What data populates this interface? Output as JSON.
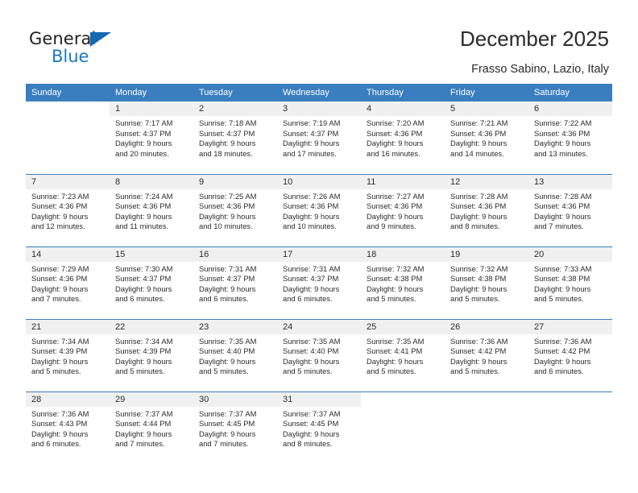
{
  "brand": {
    "name_part1": "General",
    "name_part2": "Blue",
    "triangle_color": "#1668b3",
    "blue_color": "#1b7ac4"
  },
  "header": {
    "title": "December 2025",
    "subtitle": "Frasso Sabino, Lazio, Italy"
  },
  "theme": {
    "header_blue": "#3a7ebf",
    "daynum_band": "#f0f0f0",
    "text": "#2b2b2b"
  },
  "weekday_headers": [
    "Sunday",
    "Monday",
    "Tuesday",
    "Wednesday",
    "Thursday",
    "Friday",
    "Saturday"
  ],
  "weeks": [
    [
      {
        "day": "",
        "sunrise": "",
        "sunset": "",
        "daylight1": "",
        "daylight2": "",
        "blank": true
      },
      {
        "day": "1",
        "sunrise": "Sunrise: 7:17 AM",
        "sunset": "Sunset: 4:37 PM",
        "daylight1": "Daylight: 9 hours",
        "daylight2": "and 20 minutes."
      },
      {
        "day": "2",
        "sunrise": "Sunrise: 7:18 AM",
        "sunset": "Sunset: 4:37 PM",
        "daylight1": "Daylight: 9 hours",
        "daylight2": "and 18 minutes."
      },
      {
        "day": "3",
        "sunrise": "Sunrise: 7:19 AM",
        "sunset": "Sunset: 4:37 PM",
        "daylight1": "Daylight: 9 hours",
        "daylight2": "and 17 minutes."
      },
      {
        "day": "4",
        "sunrise": "Sunrise: 7:20 AM",
        "sunset": "Sunset: 4:36 PM",
        "daylight1": "Daylight: 9 hours",
        "daylight2": "and 16 minutes."
      },
      {
        "day": "5",
        "sunrise": "Sunrise: 7:21 AM",
        "sunset": "Sunset: 4:36 PM",
        "daylight1": "Daylight: 9 hours",
        "daylight2": "and 14 minutes."
      },
      {
        "day": "6",
        "sunrise": "Sunrise: 7:22 AM",
        "sunset": "Sunset: 4:36 PM",
        "daylight1": "Daylight: 9 hours",
        "daylight2": "and 13 minutes."
      }
    ],
    [
      {
        "day": "7",
        "sunrise": "Sunrise: 7:23 AM",
        "sunset": "Sunset: 4:36 PM",
        "daylight1": "Daylight: 9 hours",
        "daylight2": "and 12 minutes."
      },
      {
        "day": "8",
        "sunrise": "Sunrise: 7:24 AM",
        "sunset": "Sunset: 4:36 PM",
        "daylight1": "Daylight: 9 hours",
        "daylight2": "and 11 minutes."
      },
      {
        "day": "9",
        "sunrise": "Sunrise: 7:25 AM",
        "sunset": "Sunset: 4:36 PM",
        "daylight1": "Daylight: 9 hours",
        "daylight2": "and 10 minutes."
      },
      {
        "day": "10",
        "sunrise": "Sunrise: 7:26 AM",
        "sunset": "Sunset: 4:36 PM",
        "daylight1": "Daylight: 9 hours",
        "daylight2": "and 10 minutes."
      },
      {
        "day": "11",
        "sunrise": "Sunrise: 7:27 AM",
        "sunset": "Sunset: 4:36 PM",
        "daylight1": "Daylight: 9 hours",
        "daylight2": "and 9 minutes."
      },
      {
        "day": "12",
        "sunrise": "Sunrise: 7:28 AM",
        "sunset": "Sunset: 4:36 PM",
        "daylight1": "Daylight: 9 hours",
        "daylight2": "and 8 minutes."
      },
      {
        "day": "13",
        "sunrise": "Sunrise: 7:28 AM",
        "sunset": "Sunset: 4:36 PM",
        "daylight1": "Daylight: 9 hours",
        "daylight2": "and 7 minutes."
      }
    ],
    [
      {
        "day": "14",
        "sunrise": "Sunrise: 7:29 AM",
        "sunset": "Sunset: 4:36 PM",
        "daylight1": "Daylight: 9 hours",
        "daylight2": "and 7 minutes."
      },
      {
        "day": "15",
        "sunrise": "Sunrise: 7:30 AM",
        "sunset": "Sunset: 4:37 PM",
        "daylight1": "Daylight: 9 hours",
        "daylight2": "and 6 minutes."
      },
      {
        "day": "16",
        "sunrise": "Sunrise: 7:31 AM",
        "sunset": "Sunset: 4:37 PM",
        "daylight1": "Daylight: 9 hours",
        "daylight2": "and 6 minutes."
      },
      {
        "day": "17",
        "sunrise": "Sunrise: 7:31 AM",
        "sunset": "Sunset: 4:37 PM",
        "daylight1": "Daylight: 9 hours",
        "daylight2": "and 6 minutes."
      },
      {
        "day": "18",
        "sunrise": "Sunrise: 7:32 AM",
        "sunset": "Sunset: 4:38 PM",
        "daylight1": "Daylight: 9 hours",
        "daylight2": "and 5 minutes."
      },
      {
        "day": "19",
        "sunrise": "Sunrise: 7:32 AM",
        "sunset": "Sunset: 4:38 PM",
        "daylight1": "Daylight: 9 hours",
        "daylight2": "and 5 minutes."
      },
      {
        "day": "20",
        "sunrise": "Sunrise: 7:33 AM",
        "sunset": "Sunset: 4:38 PM",
        "daylight1": "Daylight: 9 hours",
        "daylight2": "and 5 minutes."
      }
    ],
    [
      {
        "day": "21",
        "sunrise": "Sunrise: 7:34 AM",
        "sunset": "Sunset: 4:39 PM",
        "daylight1": "Daylight: 9 hours",
        "daylight2": "and 5 minutes."
      },
      {
        "day": "22",
        "sunrise": "Sunrise: 7:34 AM",
        "sunset": "Sunset: 4:39 PM",
        "daylight1": "Daylight: 9 hours",
        "daylight2": "and 5 minutes."
      },
      {
        "day": "23",
        "sunrise": "Sunrise: 7:35 AM",
        "sunset": "Sunset: 4:40 PM",
        "daylight1": "Daylight: 9 hours",
        "daylight2": "and 5 minutes."
      },
      {
        "day": "24",
        "sunrise": "Sunrise: 7:35 AM",
        "sunset": "Sunset: 4:40 PM",
        "daylight1": "Daylight: 9 hours",
        "daylight2": "and 5 minutes."
      },
      {
        "day": "25",
        "sunrise": "Sunrise: 7:35 AM",
        "sunset": "Sunset: 4:41 PM",
        "daylight1": "Daylight: 9 hours",
        "daylight2": "and 5 minutes."
      },
      {
        "day": "26",
        "sunrise": "Sunrise: 7:36 AM",
        "sunset": "Sunset: 4:42 PM",
        "daylight1": "Daylight: 9 hours",
        "daylight2": "and 5 minutes."
      },
      {
        "day": "27",
        "sunrise": "Sunrise: 7:36 AM",
        "sunset": "Sunset: 4:42 PM",
        "daylight1": "Daylight: 9 hours",
        "daylight2": "and 6 minutes."
      }
    ],
    [
      {
        "day": "28",
        "sunrise": "Sunrise: 7:36 AM",
        "sunset": "Sunset: 4:43 PM",
        "daylight1": "Daylight: 9 hours",
        "daylight2": "and 6 minutes."
      },
      {
        "day": "29",
        "sunrise": "Sunrise: 7:37 AM",
        "sunset": "Sunset: 4:44 PM",
        "daylight1": "Daylight: 9 hours",
        "daylight2": "and 7 minutes."
      },
      {
        "day": "30",
        "sunrise": "Sunrise: 7:37 AM",
        "sunset": "Sunset: 4:45 PM",
        "daylight1": "Daylight: 9 hours",
        "daylight2": "and 7 minutes."
      },
      {
        "day": "31",
        "sunrise": "Sunrise: 7:37 AM",
        "sunset": "Sunset: 4:45 PM",
        "daylight1": "Daylight: 9 hours",
        "daylight2": "and 8 minutes."
      },
      {
        "day": "",
        "sunrise": "",
        "sunset": "",
        "daylight1": "",
        "daylight2": "",
        "blank": true
      },
      {
        "day": "",
        "sunrise": "",
        "sunset": "",
        "daylight1": "",
        "daylight2": "",
        "blank": true
      },
      {
        "day": "",
        "sunrise": "",
        "sunset": "",
        "daylight1": "",
        "daylight2": "",
        "blank": true
      }
    ]
  ]
}
